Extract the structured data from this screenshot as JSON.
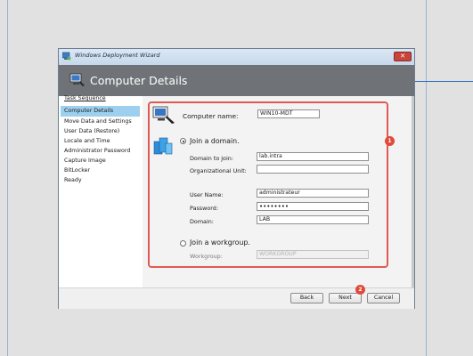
{
  "window": {
    "title": "Windows Deployment Wizard",
    "close_glyph": "✕"
  },
  "header": {
    "title": "Computer Details"
  },
  "sidebar": {
    "title": "Task Sequence",
    "items": [
      {
        "label": "Computer Details",
        "active": true
      },
      {
        "label": "Move Data and Settings"
      },
      {
        "label": "User Data (Restore)"
      },
      {
        "label": "Locale and Time"
      },
      {
        "label": "Administrator Password"
      },
      {
        "label": "Capture Image"
      },
      {
        "label": "BitLocker"
      },
      {
        "label": "Ready"
      }
    ]
  },
  "form": {
    "computer_name_label": "Computer name:",
    "computer_name_value": "WIN10-MDT",
    "join_domain_label": "Join a domain.",
    "domain_label": "Domain to join:",
    "domain_value": "lab.intra",
    "ou_label": "Organizational Unit:",
    "ou_value": "",
    "username_label": "User Name:",
    "username_value": "administrateur",
    "password_label": "Password:",
    "password_value": "••••••••",
    "user_domain_label": "Domain:",
    "user_domain_value": "LAB",
    "join_workgroup_label": "Join a workgroup.",
    "workgroup_label": "Workgroup:",
    "workgroup_value": "WORKGROUP"
  },
  "annotations": {
    "badge1": "1",
    "badge2": "2"
  },
  "buttons": {
    "back": "Back",
    "next": "Next",
    "cancel": "Cancel"
  },
  "colors": {
    "accent_highlight": "#e05a55",
    "header_bg": "#6f7377",
    "active_item": "#9dd0ee"
  }
}
